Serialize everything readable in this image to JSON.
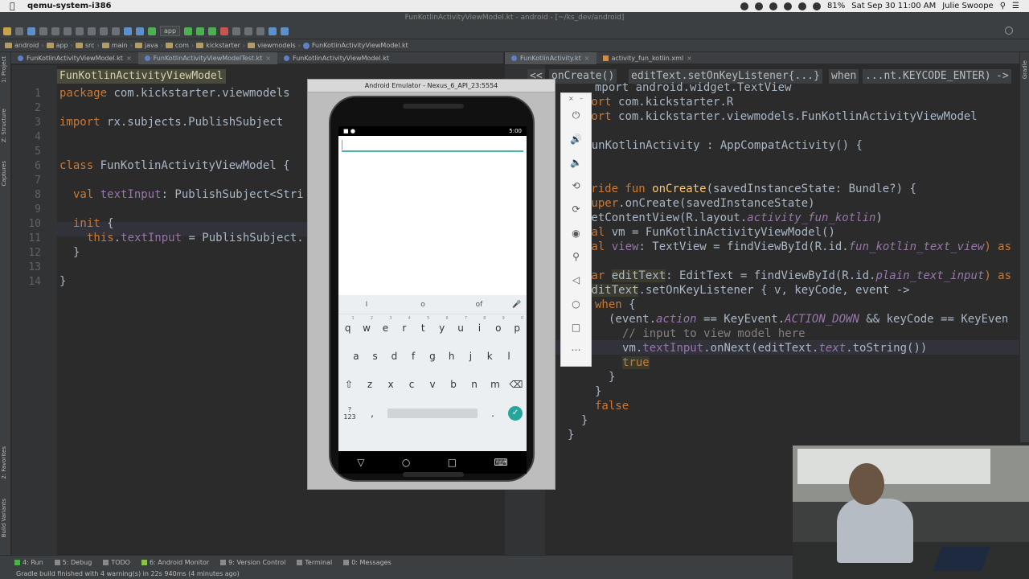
{
  "menubar": {
    "app_name": "qemu-system-i386",
    "battery": "81%",
    "datetime": "Sat Sep 30  11:00 AM",
    "user": "Julie Swoope"
  },
  "window": {
    "title": "FunKotlinActivityViewModel.kt - android - [~/ks_dev/android]"
  },
  "toolbar": {
    "run_config": "app"
  },
  "breadcrumb": [
    "android",
    "app",
    "src",
    "main",
    "java",
    "com",
    "kickstarter",
    "viewmodels",
    "FunKotlinActivityViewModel.kt"
  ],
  "left_tabs": [
    {
      "label": "FunKotlinActivityViewModel.kt",
      "active": false
    },
    {
      "label": "FunKotlinActivityViewModelTest.kt",
      "active": true
    },
    {
      "label": "FunKotlinActivityViewModel.kt",
      "active": false
    }
  ],
  "right_tabs": [
    {
      "label": "FunKotlinActivity.kt",
      "active": true
    },
    {
      "label": "activity_fun_kotlin.xml",
      "active": false
    }
  ],
  "side_labels": {
    "project": "1: Project",
    "structure": "Z: Structure",
    "captures": "Captures",
    "favorites": "2: Favorites",
    "build_variants": "Build Variants",
    "gradle": "Gradle"
  },
  "left_editor": {
    "breadcrumb": "FunKotlinActivityViewModel",
    "line_numbers": [
      "1",
      "2",
      "3",
      "4",
      "5",
      "6",
      "7",
      "8",
      "9",
      "10",
      "11",
      "12",
      "13",
      "14"
    ],
    "lines": {
      "l1a": "package ",
      "l1b": "com.kickstarter.viewmodels",
      "l3a": "import ",
      "l3b": "rx.subjects.PublishSubject",
      "l6a": "class ",
      "l6b": "FunKotlinActivityViewModel {",
      "l8a": "val ",
      "l8b": "textInput",
      "l8c": ": PublishSubject<Stri",
      "l10a": "init ",
      "l10b": "{",
      "l11a": "this",
      "l11b": ".",
      "l11c": "textInput",
      "l11d": " = PublishSubject.",
      "l12": "}",
      "l14": "}"
    }
  },
  "right_editor": {
    "crumbs": [
      "<<",
      "onCreate()",
      "editText.setOnKeyListener{...}",
      "when",
      "...nt.KEYCODE_ENTER)",
      "->"
    ],
    "lines": {
      "r1": "mport android.widget.TextView",
      "r2a": "import ",
      "r2b": "com.kickstarter.R",
      "r3a": "import ",
      "r3b": "com.kickstarter.viewmodels.FunKotlinActivityViewModel",
      "r5a": "ss ",
      "r5b": "FunKotlinActivity : AppCompatActivity() {",
      "r7a": "verride fun ",
      "r7b": "onCreate",
      "r7c": "(savedInstanceState: Bundle?) {",
      "r8a": "super",
      "r8b": ".onCreate(savedInstanceState)",
      "r9a": "setContentView(R.layout.",
      "r9b": "activity_fun_kotlin",
      "r9c": ")",
      "r10a": "val ",
      "r10b": "vm = FunKotlinActivityViewModel()",
      "r11a": "val ",
      "r11b": "view",
      "r11c": ": TextView = findViewById(R.id.",
      "r11d": "fun_kotlin_text_view",
      "r11e": ") as",
      "r13a": "var ",
      "r13b": "editText",
      "r13c": ": EditText = findViewById(R.id.",
      "r13d": "plain_text_input",
      "r13e": ") as",
      "r14a": "editText",
      "r14b": ".setOnKeyListener { v, keyCode, event ->",
      "r15a": "when ",
      "r15b": "{",
      "r16a": "(event.",
      "r16b": "action",
      "r16c": " == KeyEvent.",
      "r16d": "ACTION_DOWN",
      "r16e": " && keyCode == KeyEven",
      "r17": "// input to view model here",
      "r18a": "vm.",
      "r18b": "textInput",
      "r18c": ".onNext(editText.",
      "r18d": "text",
      "r18e": ".toString())",
      "r19": "true",
      "r20": "}",
      "r21": "}",
      "r22": "false",
      "r23": "}",
      "r24": "}"
    }
  },
  "emulator": {
    "title": "Android Emulator - Nexus_6_API_23:5554",
    "clock": "5:00",
    "suggestions": [
      "I",
      "o",
      "of"
    ],
    "row1": [
      "q",
      "w",
      "e",
      "r",
      "t",
      "y",
      "u",
      "i",
      "o",
      "p"
    ],
    "row1_digits": [
      "1",
      "2",
      "3",
      "4",
      "5",
      "6",
      "7",
      "8",
      "9",
      "0"
    ],
    "row2": [
      "a",
      "s",
      "d",
      "f",
      "g",
      "h",
      "j",
      "k",
      "l"
    ],
    "row3": [
      "z",
      "x",
      "c",
      "v",
      "b",
      "n",
      "m"
    ],
    "symbols_key": "?123",
    "comma_key": ",",
    "period_key": ".",
    "controls": [
      "power-icon",
      "volume-up-icon",
      "volume-down-icon",
      "rotate-left-icon",
      "rotate-right-icon",
      "camera-icon",
      "zoom-icon",
      "back-icon",
      "home-icon",
      "overview-icon",
      "more-icon"
    ]
  },
  "bottombar": {
    "items": [
      "4: Run",
      "5: Debug",
      "TODO",
      "6: Android Monitor",
      "9: Version Control",
      "Terminal",
      "0: Messages"
    ]
  },
  "status": {
    "text": "Gradle build finished with 4 warning(s) in 22s 940ms (4 minutes ago)"
  },
  "colors": {
    "editor_bg": "#2b2b2b",
    "keyword": "#cc7832",
    "function": "#ffc66d",
    "property": "#9876aa",
    "accent_teal": "#26a69a"
  }
}
